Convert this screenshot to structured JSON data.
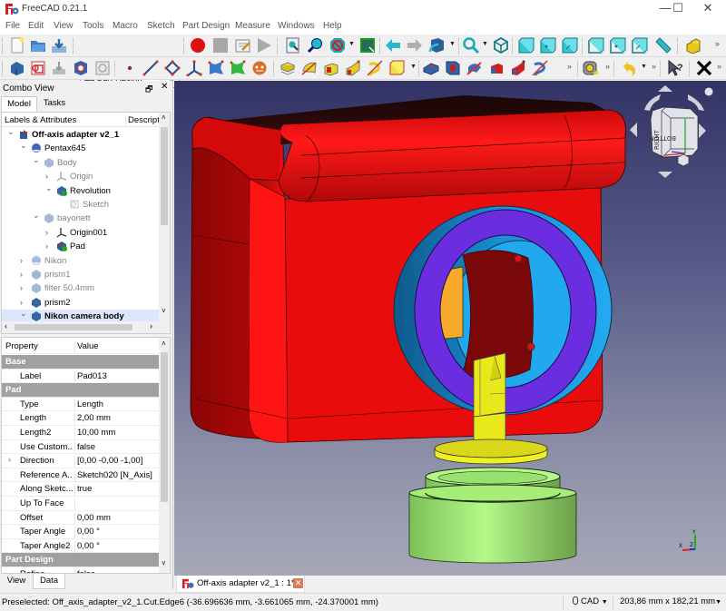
{
  "window": {
    "title": "FreeCAD 0.21.1",
    "minimize": "—",
    "maximize": "☐",
    "close": "✕"
  },
  "menu": [
    "File",
    "Edit",
    "View",
    "Tools",
    "Macro",
    "Sketch",
    "Part Design",
    "Measure",
    "Windows",
    "Help"
  ],
  "toolbar": {
    "workbench": "Part Design",
    "more": "»"
  },
  "combo_view": {
    "title": "Combo View",
    "float_icon": "🗗",
    "close_icon": "✕",
    "tabs": [
      "Model",
      "Tasks"
    ],
    "active_tab": "Model",
    "tree": {
      "col_labels": "Labels & Attributes",
      "col_desc": "Descript",
      "items": [
        {
          "label": "Off-axis adapter v2_1",
          "level": 0,
          "expanded": true,
          "bold": true,
          "icon": "document-icon"
        },
        {
          "label": "Pentax645",
          "level": 1,
          "expanded": true,
          "icon": "part-icon"
        },
        {
          "label": "Body",
          "level": 2,
          "expanded": true,
          "greyed": true,
          "icon": "body-icon"
        },
        {
          "label": "Origin",
          "level": 3,
          "expanded": false,
          "greyed": true,
          "icon": "origin-icon"
        },
        {
          "label": "Revolution",
          "level": 3,
          "expanded": true,
          "icon": "revolution-icon"
        },
        {
          "label": "Sketch",
          "level": 4,
          "greyed": true,
          "icon": "sketch-icon"
        },
        {
          "label": "bayonett",
          "level": 2,
          "expanded": true,
          "greyed": true,
          "icon": "body-icon"
        },
        {
          "label": "Origin001",
          "level": 3,
          "expanded": false,
          "icon": "origin-icon"
        },
        {
          "label": "Pad",
          "level": 3,
          "expanded": false,
          "icon": "pad-icon"
        },
        {
          "label": "Nikon",
          "level": 1,
          "expanded": false,
          "greyed": true,
          "icon": "part-icon"
        },
        {
          "label": "prism1",
          "level": 1,
          "expanded": false,
          "greyed": true,
          "icon": "body-icon"
        },
        {
          "label": "filter 50.4mm",
          "level": 1,
          "expanded": false,
          "greyed": true,
          "icon": "body-icon"
        },
        {
          "label": "prism2",
          "level": 1,
          "expanded": false,
          "icon": "body-icon"
        },
        {
          "label": "Nikon camera body",
          "level": 1,
          "expanded": true,
          "bold": true,
          "selected": true,
          "icon": "body-icon"
        }
      ]
    },
    "properties": {
      "col_property": "Property",
      "col_value": "Value",
      "rows": [
        {
          "group": "Base"
        },
        {
          "key": "Label",
          "value": "Pad013"
        },
        {
          "group": "Pad"
        },
        {
          "key": "Type",
          "value": "Length"
        },
        {
          "key": "Length",
          "value": "2,00 mm"
        },
        {
          "key": "Length2",
          "value": "10,00 mm"
        },
        {
          "key": "Use Custom...",
          "value": "false"
        },
        {
          "key": "Direction",
          "value": "[0,00 -0,00 -1,00]",
          "expandable": true
        },
        {
          "key": "Reference A...",
          "value": "Sketch020 [N_Axis]"
        },
        {
          "key": "Along Sketc...",
          "value": "true"
        },
        {
          "key": "Up To Face",
          "value": ""
        },
        {
          "key": "Offset",
          "value": "0,00 mm"
        },
        {
          "key": "Taper Angle",
          "value": "0,00 °"
        },
        {
          "key": "Taper Angle2",
          "value": "0,00 °"
        },
        {
          "group": "Part Design"
        },
        {
          "key": "Refine",
          "value": "false"
        }
      ]
    },
    "bottom_tabs": [
      "View",
      "Data"
    ],
    "active_bottom_tab": "Data"
  },
  "viewport": {
    "navcube_faces": {
      "right": "RIGHT",
      "bottom": "BOTTOM"
    },
    "axis_labels": {
      "x": "X",
      "y": "Y",
      "z": "Z"
    },
    "colors": {
      "background_top": "#333366",
      "camera_body": "#ee1111",
      "mount_ring": "#1a8fd6",
      "filter_ring": "#6a2ee0",
      "prism": "#e8e81a",
      "adapter": "#aef07a",
      "orange_insert": "#f7a92a"
    }
  },
  "document_tab": {
    "label": "Off-axis adapter v2_1 : 1*",
    "close": "✕"
  },
  "status": {
    "message": "Preselected: Off_axis_adapter_v2_1.Cut.Edge6 (-36.696636 mm, -3.661065 mm, -24.370001 mm)",
    "navigation_style": "CAD",
    "dimensions": "203,86 mm x 182,21 mm"
  }
}
